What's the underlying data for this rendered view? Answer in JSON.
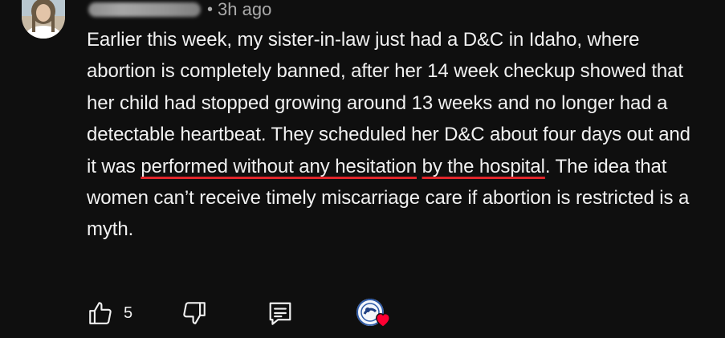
{
  "comment": {
    "timestamp": "3h ago",
    "separator": "•",
    "text": {
      "part1": "Earlier this week, my sister-in-law just had a D&C in Idaho, where abortion is completely banned, after her 14 week checkup showed that her child had stopped growing around 13 weeks and no longer had a detectable heartbeat. They scheduled her D&C about four days out and it was ",
      "underline1": "performed without any hesitation",
      "space": " ",
      "underline2": "by the hospital",
      "part2": ". The idea that women can’t receive timely miscarriage care if abortion is restricted is a myth."
    },
    "underline_color": "#e0262b"
  },
  "actions": {
    "like_count": "5",
    "like_icon": "thumbs-up-icon",
    "dislike_icon": "thumbs-down-icon",
    "reply_icon": "reply-comment-icon",
    "creator_heart_icon": "creator-heart-icon",
    "heart_color": "#ff0033"
  }
}
